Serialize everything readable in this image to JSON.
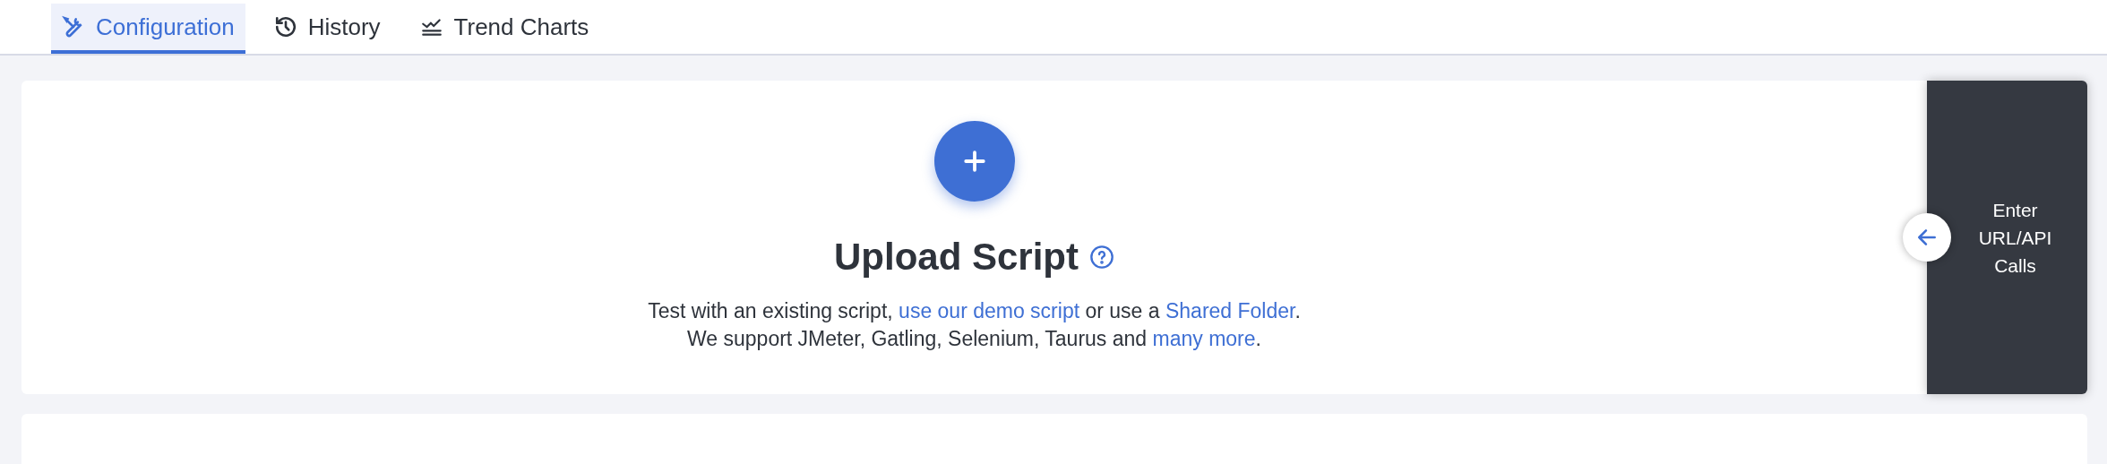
{
  "tabs": [
    {
      "label": "Configuration",
      "kind": "tools",
      "selected": true
    },
    {
      "label": "History",
      "kind": "history",
      "selected": false
    },
    {
      "label": "Trend Charts",
      "kind": "chart",
      "selected": false
    }
  ],
  "upload": {
    "title": "Upload Script",
    "lines": [
      [
        {
          "kind": "text",
          "text": "Test with an existing script, "
        },
        {
          "kind": "link",
          "text": "use our demo script"
        },
        {
          "kind": "text",
          "text": " or use a "
        },
        {
          "kind": "link",
          "text": "Shared Folder"
        },
        {
          "kind": "text",
          "text": "."
        }
      ],
      [
        {
          "kind": "text",
          "text": "We support JMeter, Gatling, Selenium, Taurus and "
        },
        {
          "kind": "link",
          "text": "many more"
        },
        {
          "kind": "text",
          "text": "."
        }
      ]
    ]
  },
  "side_panel": {
    "label": "Enter URL/API Calls"
  }
}
